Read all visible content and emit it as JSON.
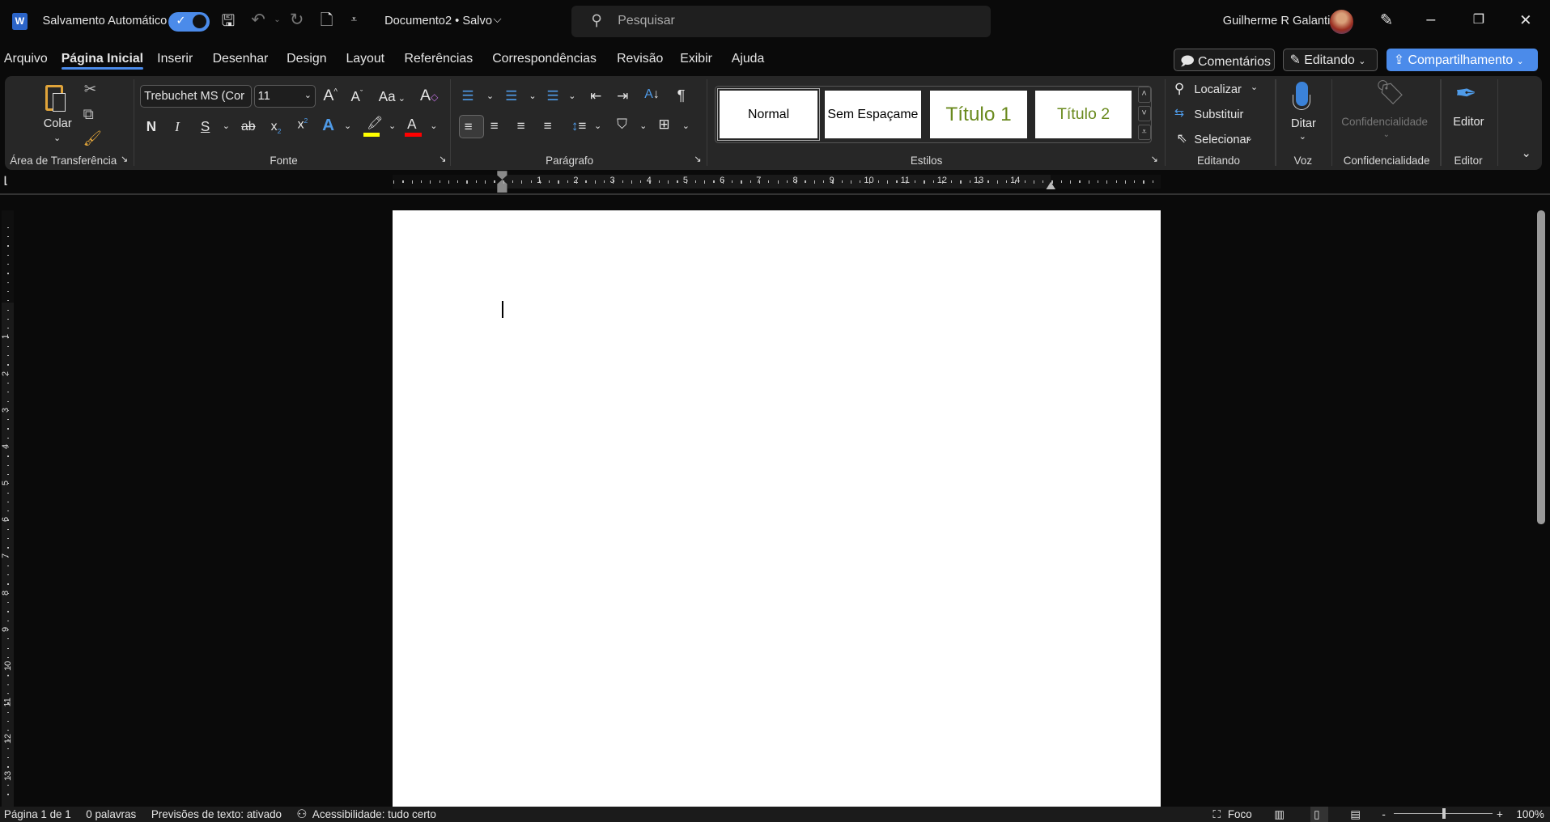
{
  "titlebar": {
    "autosave_label": "Salvamento Automático",
    "autosave_on": true,
    "doc_title": "Documento2 • Salvo",
    "search_placeholder": "Pesquisar",
    "user_name": "Guilherme R Galanti",
    "app_icon": "W"
  },
  "tabs": [
    "Arquivo",
    "Página Inicial",
    "Inserir",
    "Desenhar",
    "Design",
    "Layout",
    "Referências",
    "Correspondências",
    "Revisão",
    "Exibir",
    "Ajuda"
  ],
  "active_tab": "Página Inicial",
  "header_buttons": {
    "comments": "Comentários",
    "editing": "Editando",
    "share": "Compartilhamento"
  },
  "ribbon": {
    "clipboard": {
      "paste": "Colar",
      "label": "Área de Transferência"
    },
    "font": {
      "name": "Trebuchet MS (Cor",
      "size": "11",
      "label": "Fonte",
      "bold": "N",
      "italic": "I",
      "underline": "S",
      "change_case": "Aa",
      "highlight_color": "#ffff00",
      "font_color": "#ff0000"
    },
    "paragraph": {
      "label": "Parágrafo"
    },
    "styles": {
      "items": [
        "Normal",
        "Sem Espaçame",
        "Título 1",
        "Título 2"
      ],
      "label": "Estilos",
      "heading_color": "#6a8a1e"
    },
    "editing": {
      "find": "Localizar",
      "replace": "Substituir",
      "select": "Selecionar",
      "label": "Editando"
    },
    "voice": {
      "dictate": "Ditar",
      "label": "Voz"
    },
    "sensitivity": {
      "button": "Confidencialidade",
      "label": "Confidencialidade"
    },
    "editor": {
      "button": "Editor",
      "label": "Editor"
    }
  },
  "ruler": {
    "h": [
      "1",
      "2",
      "3",
      "4",
      "5",
      "6",
      "7",
      "8",
      "9",
      "10",
      "11",
      "12",
      "13",
      "14"
    ],
    "v": [
      "1",
      "2",
      "3",
      "4",
      "5",
      "6",
      "7",
      "8",
      "9",
      "10",
      "11",
      "12",
      "13"
    ]
  },
  "status": {
    "page": "Página 1 de 1",
    "words": "0 palavras",
    "predictions": "Previsões de texto: ativado",
    "accessibility": "Acessibilidade: tudo certo",
    "focus": "Foco",
    "zoom": "100%",
    "zoom_percent": 100
  },
  "colors": {
    "accent": "#4b8bea"
  }
}
